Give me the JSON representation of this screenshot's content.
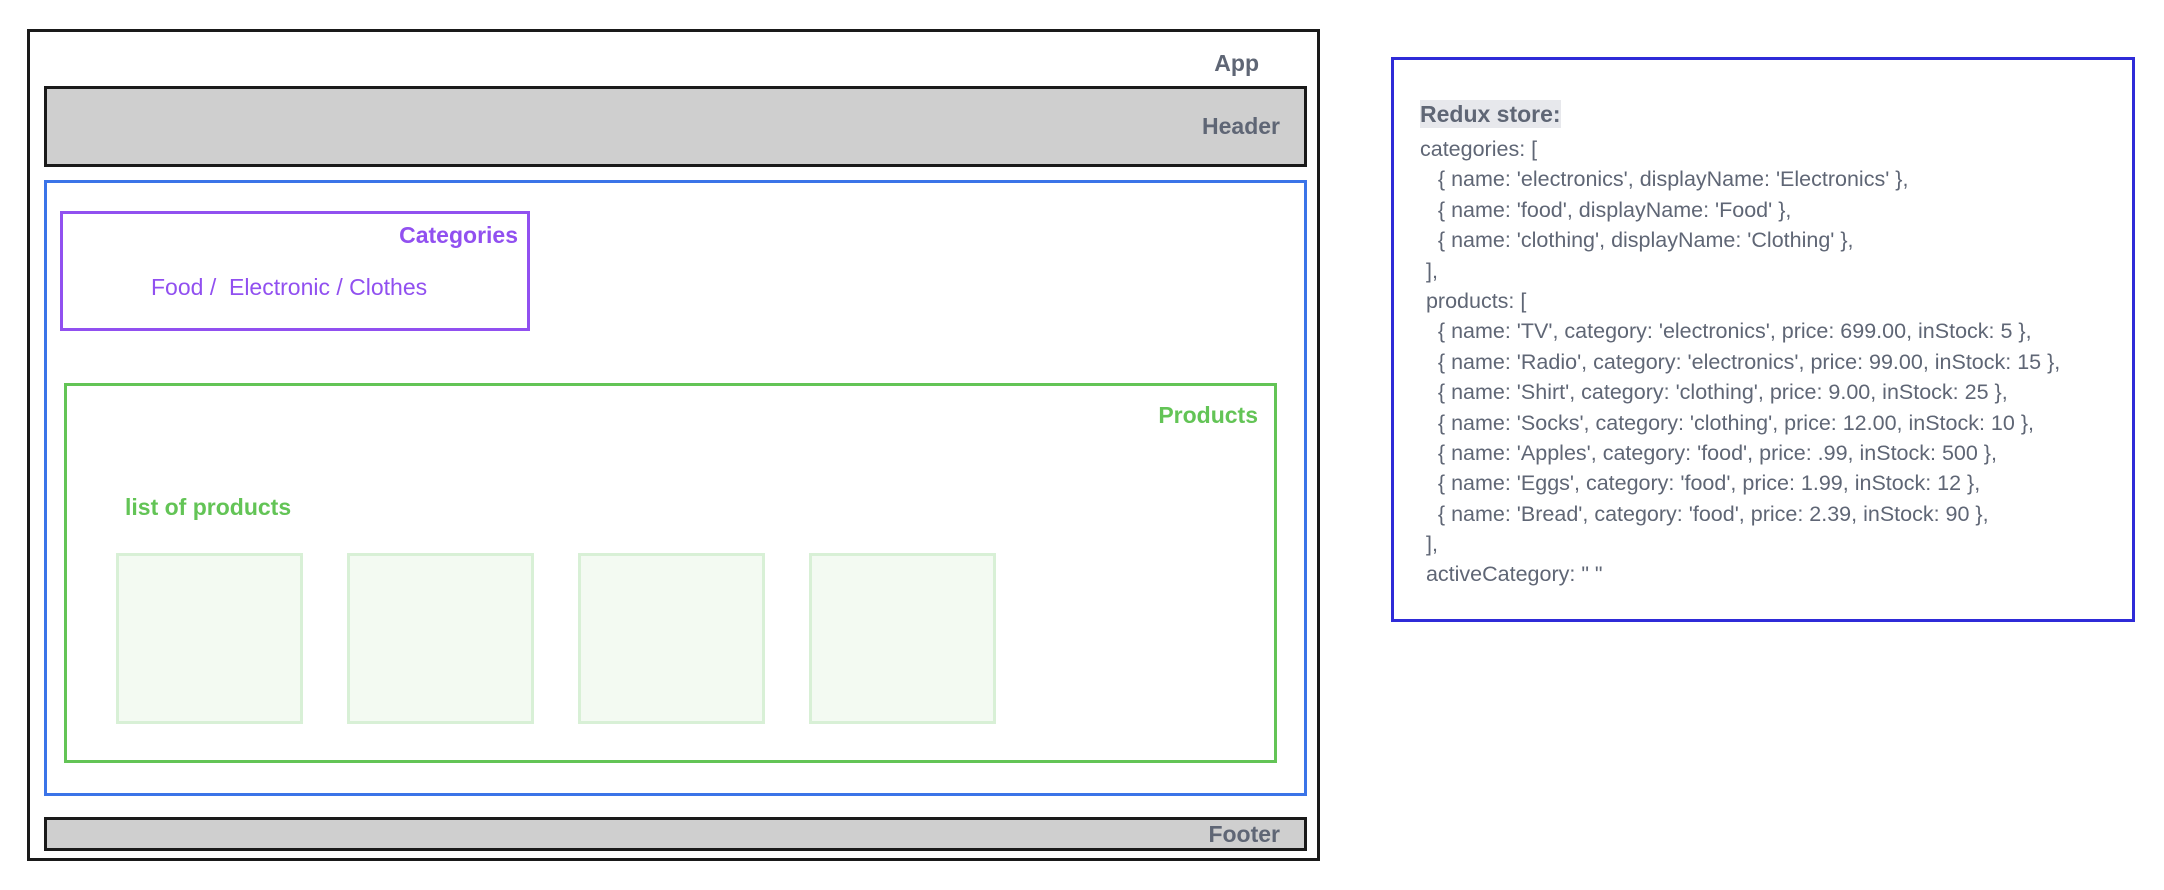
{
  "app": {
    "label": "App",
    "header": {
      "label": "Header"
    },
    "categories": {
      "title": "Categories",
      "links": "Food /  Electronic / Clothes"
    },
    "products": {
      "title": "Products",
      "subtitle": "list of products",
      "card_count": 4
    },
    "footer": {
      "label": "Footer"
    }
  },
  "store": {
    "title": "Redux store:",
    "lines": [
      "categories: [",
      "   { name: 'electronics', displayName: 'Electronics' },",
      "   { name: 'food', displayName: 'Food' },",
      "   { name: 'clothing', displayName: 'Clothing' },",
      " ],",
      " products: [",
      "   { name: 'TV', category: 'electronics', price: 699.00, inStock: 5 },",
      "   { name: 'Radio', category: 'electronics', price: 99.00, inStock: 15 },",
      "   { name: 'Shirt', category: 'clothing', price: 9.00, inStock: 25 },",
      "   { name: 'Socks', category: 'clothing', price: 12.00, inStock: 10 },",
      "   { name: 'Apples', category: 'food', price: .99, inStock: 500 },",
      "   { name: 'Eggs', category: 'food', price: 1.99, inStock: 12 },",
      "   { name: 'Bread', category: 'food', price: 2.39, inStock: 90 },",
      " ],",
      " activeCategory: \" \""
    ]
  },
  "colors": {
    "app_border": "#1a1a1a",
    "main_border": "#3b74e8",
    "categories": "#9150f0",
    "products": "#63c456",
    "store_border": "#2f2bd8",
    "label_gray": "#5f6675"
  }
}
